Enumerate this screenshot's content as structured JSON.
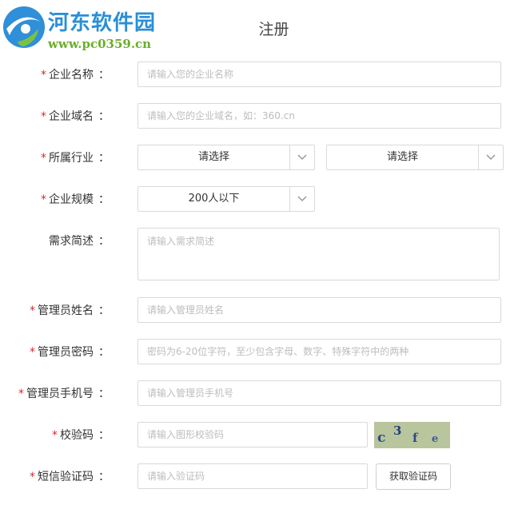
{
  "watermark": {
    "site_name": "河东软件园",
    "site_url": "www.pc0359.cn"
  },
  "page": {
    "title": "注册"
  },
  "form": {
    "required_mark": "*",
    "colon": "：",
    "company_name": {
      "label": "企业名称",
      "placeholder": "请输入您的企业名称"
    },
    "company_domain": {
      "label": "企业域名",
      "placeholder": "请输入您的企业域名，如：360.cn"
    },
    "industry": {
      "label": "所属行业",
      "select1": "请选择",
      "select2": "请选择"
    },
    "company_size": {
      "label": "企业规模",
      "value": "200人以下"
    },
    "requirements": {
      "label": "需求简述",
      "placeholder": "请输入需求简述"
    },
    "admin_name": {
      "label": "管理员姓名",
      "placeholder": "请输入管理员姓名"
    },
    "admin_password": {
      "label": "管理员密码",
      "placeholder": "密码为6-20位字符，至少包含字母、数字、特殊字符中的两种"
    },
    "admin_phone": {
      "label": "管理员手机号",
      "placeholder": "请输入管理员手机号"
    },
    "captcha": {
      "label": "校验码",
      "placeholder": "请输入图形校验码",
      "image_text": "c3fe"
    },
    "sms_code": {
      "label": "短信验证码",
      "placeholder": "请输入验证码",
      "button": "获取验证码"
    }
  },
  "colors": {
    "required": "#d9282f",
    "watermark_blue": "#2a8fd6",
    "watermark_green": "#6aae2a",
    "border": "#d9d9d9",
    "placeholder": "#bdbdbd"
  }
}
